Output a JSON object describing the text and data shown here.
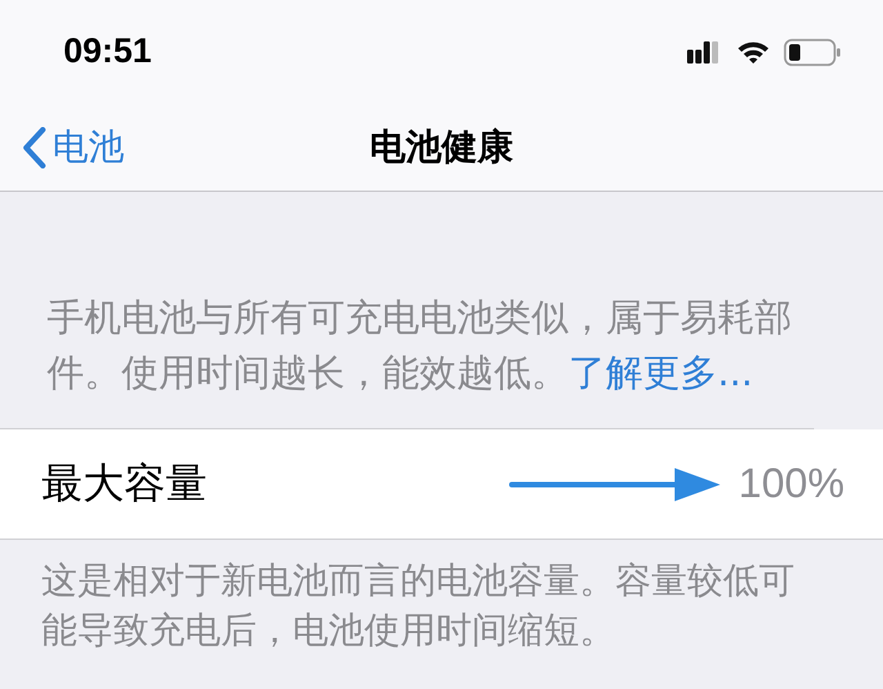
{
  "status_bar": {
    "time": "09:51"
  },
  "nav": {
    "back_label": "电池",
    "title": "电池健康"
  },
  "intro": {
    "text": "手机电池与所有可充电电池类似，属于易耗部件。使用时间越长，能效越低。",
    "link": "了解更多..."
  },
  "rows": [
    {
      "label": "最大容量",
      "value": "100%"
    }
  ],
  "footer": "这是相对于新电池而言的电池容量。容量较低可能导致充电后，电池使用时间缩短。"
}
